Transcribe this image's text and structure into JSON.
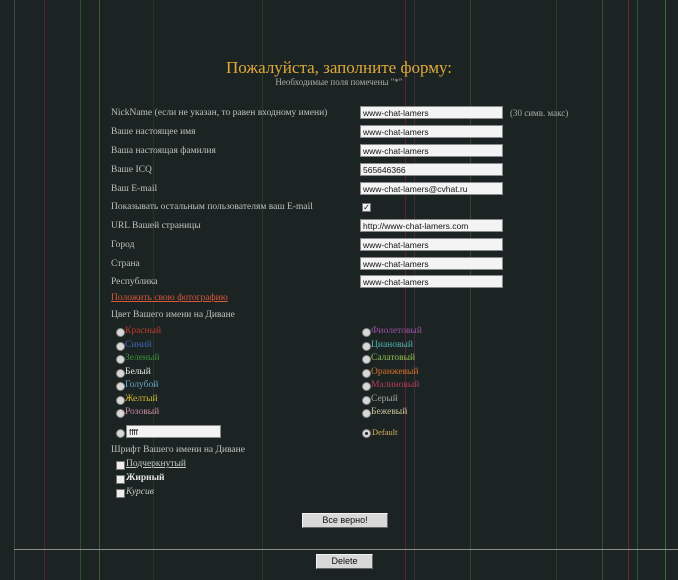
{
  "header": {
    "title": "Пожалуйста, заполните форму:",
    "subtitle": "Необходимые поля помечены \"*\""
  },
  "fields": [
    {
      "label": "NickName (если не указан, то равен входному имени)",
      "value": "www-chat-lamers"
    },
    {
      "label": "Ваше настоящее имя",
      "value": "www-chat-lamers"
    },
    {
      "label": "Ваша настоящая фамилия",
      "value": "www-chat-lamers"
    },
    {
      "label": "Ваше ICQ",
      "value": "565646366"
    },
    {
      "label": "Ваш E-mail",
      "value": "www-chat-lamers@cvhat.ru"
    },
    {
      "label": "URL Вашей страницы",
      "value": "http://www-chat-lamers.com"
    },
    {
      "label": "Город",
      "value": "www-chat-lamers"
    },
    {
      "label": "Страна",
      "value": "www-chat-lamers"
    },
    {
      "label": "Республика",
      "value": "www-chat-lamers"
    }
  ],
  "nick_hint": "(30 симв. макс)",
  "show_email": {
    "label": "Показывать остальным пользователям ваш E-mail",
    "checked": true
  },
  "photo_link": "Положить свою фотографию",
  "color_section": {
    "title": "Цвет Вашего имени на Диване",
    "left": [
      {
        "label": "Красный",
        "color": "#c0392b"
      },
      {
        "label": "Синий",
        "color": "#3f63b8"
      },
      {
        "label": "Зеленый",
        "color": "#3e8e3e"
      },
      {
        "label": "Белый",
        "color": "#e6e6e6"
      },
      {
        "label": "Голубой",
        "color": "#6aa6c8"
      },
      {
        "label": "Желтый",
        "color": "#d6b531"
      },
      {
        "label": "Розовый",
        "color": "#c98aa0"
      }
    ],
    "right": [
      {
        "label": "Фиолетовый",
        "color": "#9b4fa8"
      },
      {
        "label": "Циановый",
        "color": "#4fb3b3"
      },
      {
        "label": "Салатовый",
        "color": "#8fbf4f"
      },
      {
        "label": "Оранжевый",
        "color": "#d8702b"
      },
      {
        "label": "Малиновый",
        "color": "#b23a5a"
      },
      {
        "label": "Серый",
        "color": "#a3a3a3"
      },
      {
        "label": "Бежевый",
        "color": "#cfc2a0"
      }
    ],
    "custom_value": "ffff",
    "default_label": "Default",
    "default_color": "#d8b15a",
    "selected": "Default"
  },
  "font_section": {
    "title": "Шрифт Вашего имени на Диване",
    "underline": "Подчеркнутый",
    "bold": "Жирный",
    "italic": "Курсив"
  },
  "buttons": {
    "submit": "Все верно!",
    "delete": "Delete"
  }
}
